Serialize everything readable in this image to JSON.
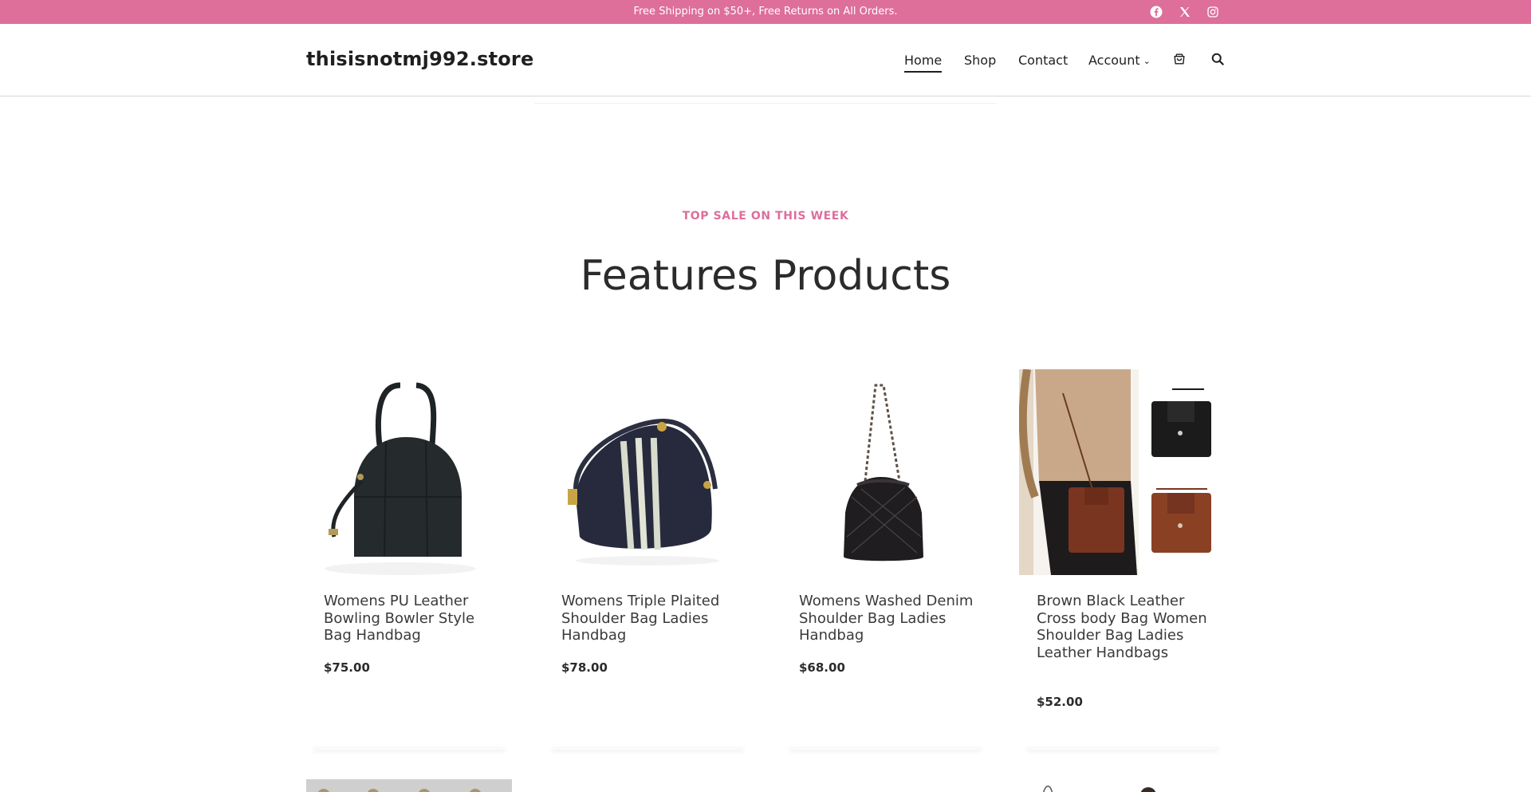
{
  "announcement": "Free Shipping on $50+, Free Returns on All Orders.",
  "social": [
    {
      "icon": "facebook-icon"
    },
    {
      "icon": "x-twitter-icon"
    },
    {
      "icon": "instagram-icon"
    }
  ],
  "brand": "thisisnotmj992.store",
  "nav": {
    "home": "Home",
    "shop": "Shop",
    "contact": "Contact",
    "account": "Account"
  },
  "header_icons": {
    "cart": "cart-icon",
    "search": "search-icon"
  },
  "colors": {
    "accent": "#dd6f9a",
    "text": "#2b2b2b"
  },
  "section": {
    "eyebrow": "TOP SALE ON THIS WEEK",
    "title": "Features Products"
  },
  "products": [
    {
      "title": "Womens PU Leather Bowling Bowler Style Bag Handbag",
      "price": "$75.00"
    },
    {
      "title": "Womens Triple Plaited Shoulder Bag Ladies Handbag",
      "price": "$78.00"
    },
    {
      "title": "Womens Washed Denim Shoulder Bag Ladies Handbag",
      "price": "$68.00"
    },
    {
      "title": "Brown Black Leather Cross body Bag Women Shoulder Bag Ladies Leather Handbags",
      "price": "$52.00"
    }
  ]
}
